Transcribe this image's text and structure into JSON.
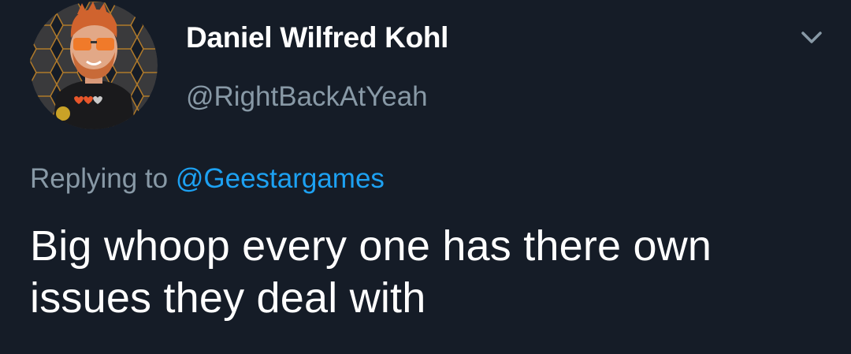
{
  "tweet": {
    "author": {
      "display_name": "Daniel Wilfred Kohl",
      "handle": "@RightBackAtYeah",
      "avatar_icon": "cartoon-avatar-with-orange-sunglasses"
    },
    "menu_icon": "chevron-down-icon",
    "reply": {
      "label": "Replying to",
      "to_handle": "@Geestargames"
    },
    "text": "Big whoop every one has there own issues they deal with"
  },
  "colors": {
    "background": "#151c27",
    "primary_text": "#ffffff",
    "secondary_text": "#8899a6",
    "link": "#1da1f2"
  }
}
